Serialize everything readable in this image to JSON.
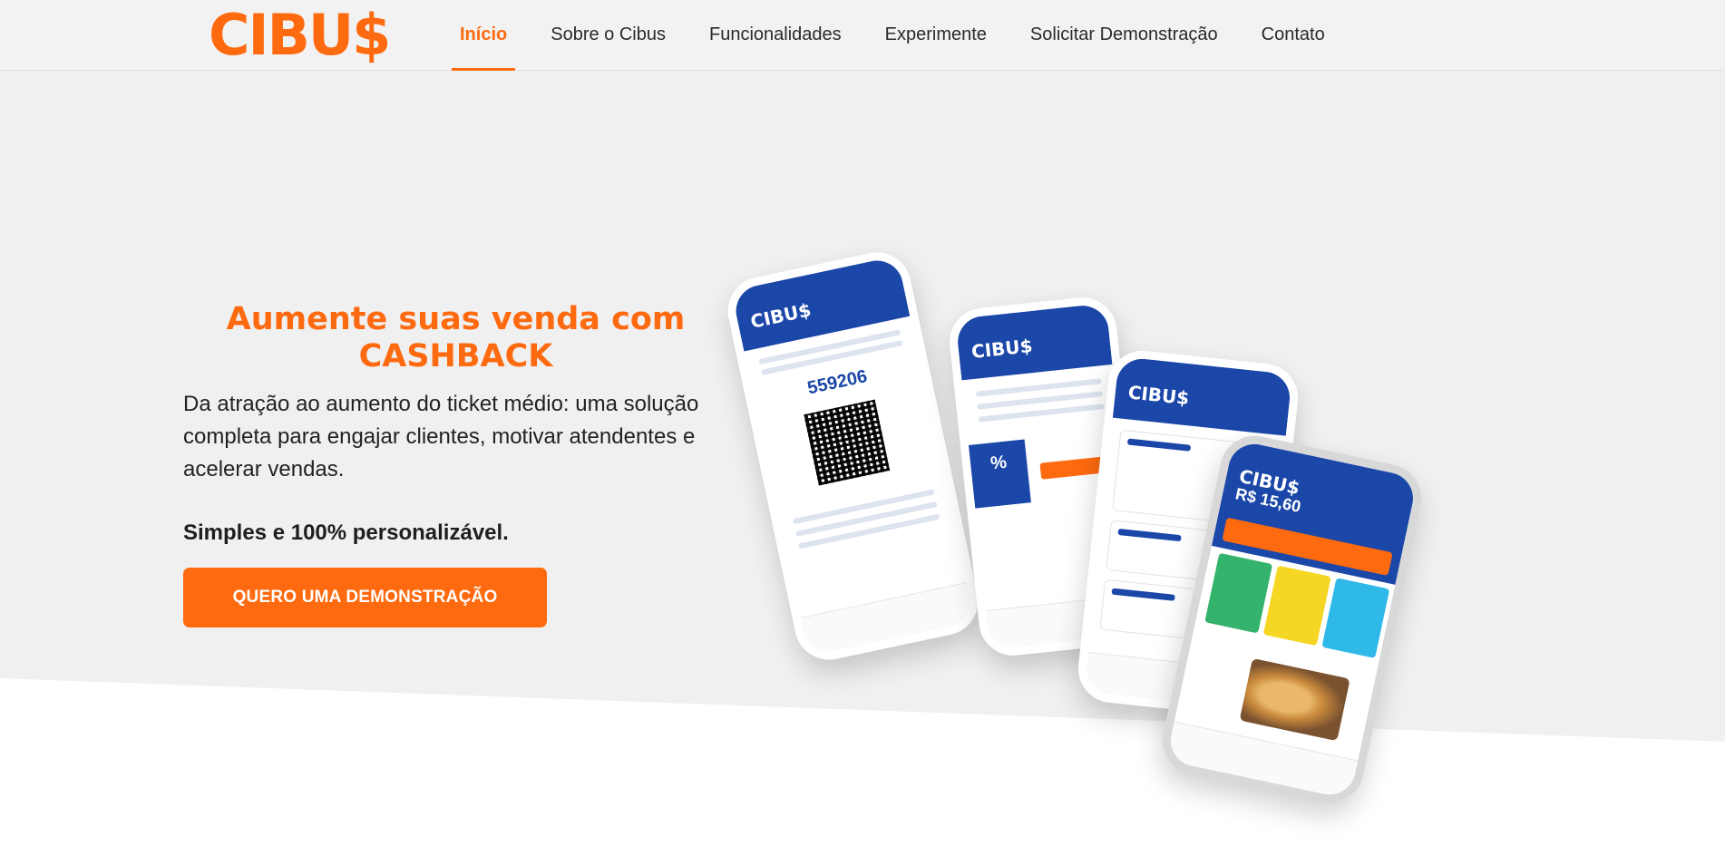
{
  "header": {
    "logo": "CIBU$",
    "nav": [
      "Início",
      "Sobre o Cibus",
      "Funcionalidades",
      "Experimente",
      "Solicitar Demonstração",
      "Contato"
    ]
  },
  "hero": {
    "headline_line1": "Aumente suas venda com",
    "headline_line2": "CASHBACK",
    "lead": "Da atração ao aumento do ticket médio: uma solução completa para engajar clientes, motivar atendentes e acelerar vendas.",
    "tagline": "Simples e 100% personalizável.",
    "cta_label": "QUERO UMA DEMONSTRAÇÃO"
  },
  "phones": {
    "brand": "CIBU$",
    "voucher_code": "559206",
    "offer_percent": "%",
    "balance": "R$ 15,60"
  },
  "colors": {
    "accent": "#fe6a0f",
    "brand_blue": "#1b47a8",
    "hero_bg": "#f0f0f0"
  }
}
